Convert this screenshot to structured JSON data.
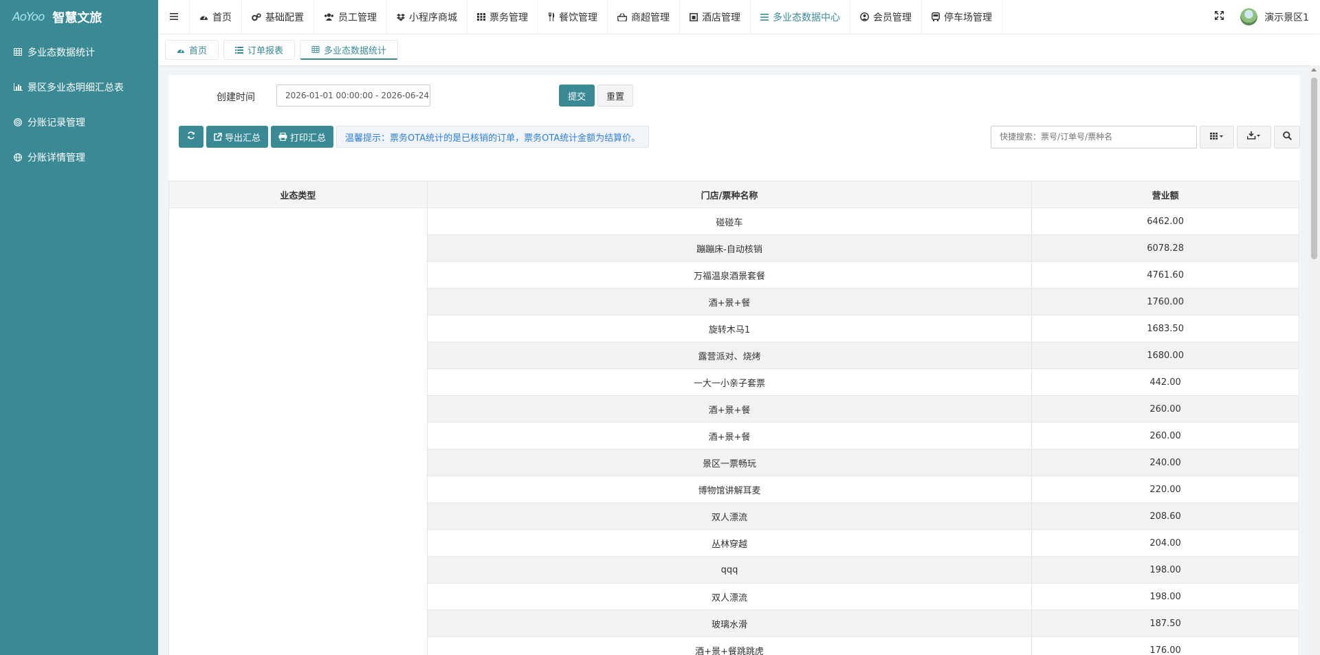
{
  "app": {
    "logo_mark": "AoYoo",
    "title": "智慧文旅"
  },
  "sidebar": {
    "items": [
      {
        "label": "多业态数据统计",
        "icon": "table-icon"
      },
      {
        "label": "景区多业态明细汇总表",
        "icon": "bar-chart-icon"
      },
      {
        "label": "分账记录管理",
        "icon": "target-icon"
      },
      {
        "label": "分账详情管理",
        "icon": "globe-icon"
      }
    ]
  },
  "topnav": {
    "items": [
      {
        "label": "首页",
        "icon": "dashboard-icon"
      },
      {
        "label": "基础配置",
        "icon": "cogs-icon"
      },
      {
        "label": "员工管理",
        "icon": "users-icon"
      },
      {
        "label": "小程序商城",
        "icon": "dropbox-icon"
      },
      {
        "label": "票务管理",
        "icon": "grid-icon"
      },
      {
        "label": "餐饮管理",
        "icon": "cutlery-icon"
      },
      {
        "label": "商超管理",
        "icon": "basket-icon"
      },
      {
        "label": "酒店管理",
        "icon": "hotel-icon"
      },
      {
        "label": "多业态数据中心",
        "icon": "list-icon"
      },
      {
        "label": "会员管理",
        "icon": "user-circle-icon"
      },
      {
        "label": "停车场管理",
        "icon": "bus-icon"
      }
    ],
    "active_index": 8,
    "user_name": "演示景区1"
  },
  "tabs": [
    {
      "label": "首页",
      "icon": "dashboard-icon"
    },
    {
      "label": "订单报表",
      "icon": "list-icon"
    },
    {
      "label": "多业态数据统计",
      "icon": "table-icon"
    }
  ],
  "search": {
    "label": "创建时间",
    "date_value": "2026-01-01 00:00:00 - 2026-06-24",
    "submit_label": "提交",
    "reset_label": "重置"
  },
  "toolbar": {
    "export_label": "导出汇总",
    "print_label": "打印汇总",
    "hint": "温馨提示：票务OTA统计的是已核销的订单，票务OTA统计金额为结算价。",
    "quick_search_placeholder": "快捷搜索：票号/订单号/票种名"
  },
  "table": {
    "headers": [
      "业态类型",
      "门店/票种名称",
      "营业额"
    ],
    "rows": [
      {
        "type": "",
        "name": "碰碰车",
        "amount": "6462.00"
      },
      {
        "type": "",
        "name": "蹦蹦床-自动核销",
        "amount": "6078.28"
      },
      {
        "type": "",
        "name": "万福温泉酒景套餐",
        "amount": "4761.60"
      },
      {
        "type": "",
        "name": "酒+景+餐",
        "amount": "1760.00"
      },
      {
        "type": "",
        "name": "旋转木马1",
        "amount": "1683.50"
      },
      {
        "type": "",
        "name": "露营派对、烧烤",
        "amount": "1680.00"
      },
      {
        "type": "",
        "name": "一大一小亲子套票",
        "amount": "442.00"
      },
      {
        "type": "",
        "name": "酒+景+餐",
        "amount": "260.00"
      },
      {
        "type": "",
        "name": "酒+景+餐",
        "amount": "260.00"
      },
      {
        "type": "",
        "name": "景区一票畅玩",
        "amount": "240.00"
      },
      {
        "type": "",
        "name": "博物馆讲解耳麦",
        "amount": "220.00"
      },
      {
        "type": "",
        "name": "双人漂流",
        "amount": "208.60"
      },
      {
        "type": "",
        "name": "丛林穿越",
        "amount": "204.00"
      },
      {
        "type": "",
        "name": "qqq",
        "amount": "198.00"
      },
      {
        "type": "",
        "name": "双人漂流",
        "amount": "198.00"
      },
      {
        "type": "",
        "name": "玻璃水滑",
        "amount": "187.50"
      },
      {
        "type": "",
        "name": "酒+景+餐跳跳虎",
        "amount": "176.00"
      }
    ]
  },
  "colors": {
    "primary": "#3a8a96",
    "hint_text": "#2f7fd1"
  }
}
